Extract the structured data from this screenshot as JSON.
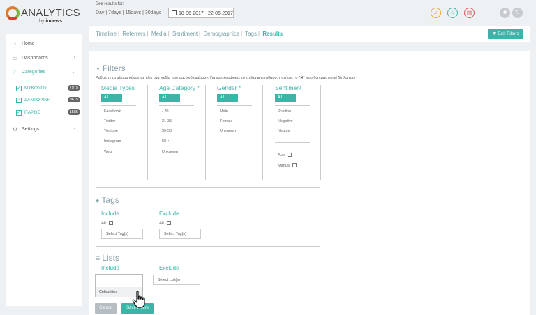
{
  "app": {
    "brand": "ANALYTICS",
    "by_prefix": "by",
    "by_brand": "innews"
  },
  "header": {
    "see_results_label": "See results for:",
    "periods": [
      "Day",
      "7days",
      "15days",
      "30days"
    ],
    "date_range": "18-06-2017 - 22-06-2017",
    "icons": [
      "check-icon",
      "star-icon",
      "trash-icon",
      "square-icon",
      "refresh-icon"
    ]
  },
  "sidebar": {
    "home": "Home",
    "dashboards": "Dashboards",
    "categories": "Categories",
    "sub_items": [
      {
        "name": "ΜΥΚΟΝΟΣ",
        "count": "7975"
      },
      {
        "name": "ΣΑΝΤΟΡΙΝΗ",
        "count": "3675"
      },
      {
        "name": "ΠΑΡΟΣ",
        "count": "1586"
      }
    ],
    "settings": "Settings"
  },
  "nav": {
    "tabs": [
      "Timeline",
      "Referrers",
      "Media",
      "Sentiment",
      "Demographics",
      "Tags",
      "Results"
    ],
    "active_tab": "Results",
    "edit_filters": "Edit Filters"
  },
  "filters": {
    "title": "Filters",
    "description": "Ρυθμίστε τα φίλτρα κάνοντας κλικ στα πεδία που σας ενδιαφέρουν. Για να ακυρώσετε το επιλεγμένο φίλτρο, πατήστε το \"✖\" που θα εμφανιστεί δίπλα του.",
    "all_label": "All",
    "media_types": {
      "title": "Media Types",
      "options": [
        "Facebook",
        "Twitter",
        "Youtube",
        "Instagram",
        "Web"
      ]
    },
    "age_category": {
      "title": "Age Category *",
      "options": [
        "- 20",
        "21-35",
        "35-50",
        "50 +",
        "Unknown"
      ]
    },
    "gender": {
      "title": "Gender *",
      "options": [
        "Male",
        "Female",
        "Unknown"
      ]
    },
    "sentiment": {
      "title": "Sentiment",
      "options": [
        "Positive",
        "Negative",
        "Neutral"
      ],
      "auto": "Auto",
      "manual": "Manual"
    }
  },
  "tags": {
    "title": "Tags",
    "include": "Include",
    "exclude": "Exclude",
    "all_label": "All",
    "include_placeholder": "Select Tag(s)",
    "exclude_placeholder": "Select Tag(s)"
  },
  "lists": {
    "title": "Lists",
    "include": "Include",
    "exclude": "Exclude",
    "exclude_placeholder": "Select List(s)",
    "dropdown_item": "Celebrities"
  },
  "actions": {
    "cancel": "Cancel",
    "save": "Save Filters"
  }
}
